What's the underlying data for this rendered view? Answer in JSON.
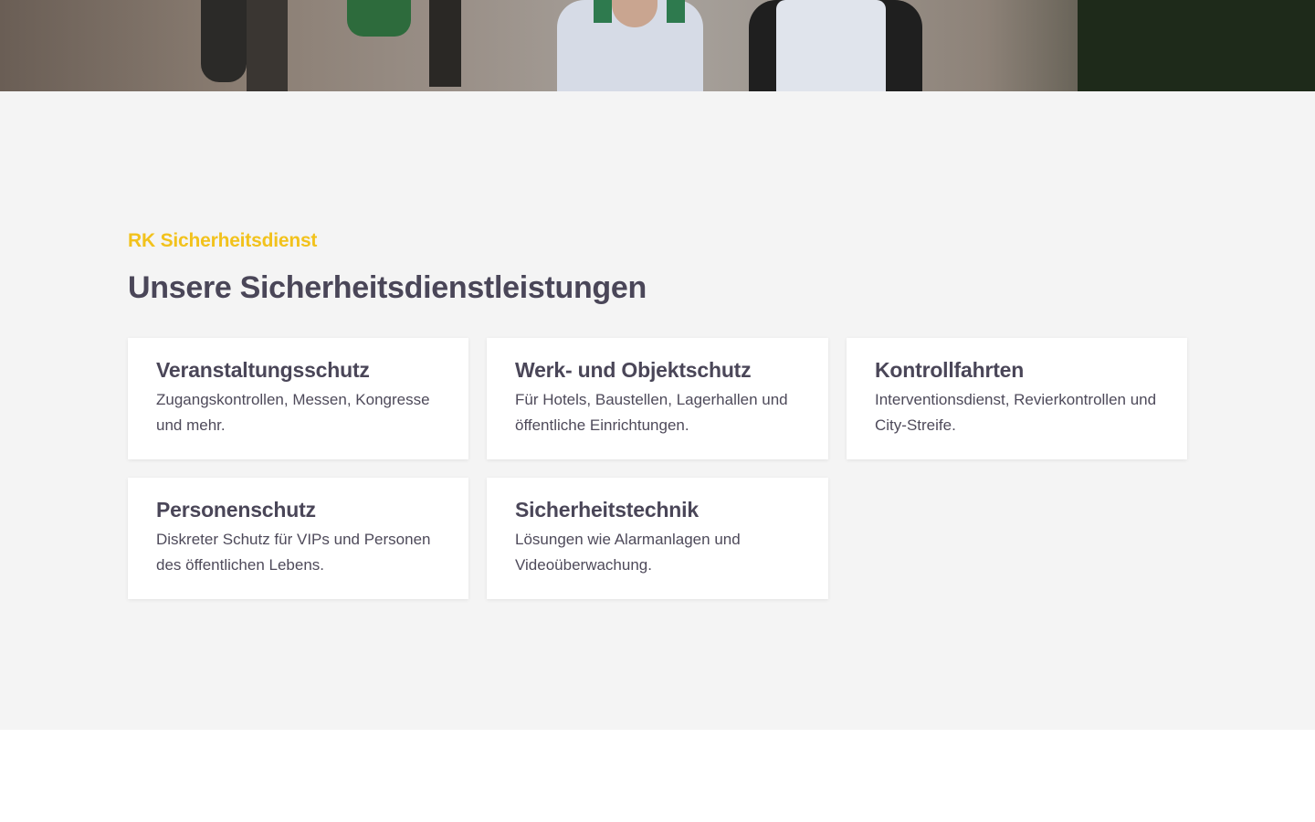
{
  "hero": {
    "image_alt": "Security staff in vests walking outdoors"
  },
  "services": {
    "eyebrow": "RK Sicherheitsdienst",
    "title": "Unsere Sicherheitsdienstleistungen",
    "cards": [
      {
        "title": "Veranstaltungsschutz",
        "text": "Zugangskontrollen, Messen, Kongresse und mehr."
      },
      {
        "title": "Werk- und Objektschutz",
        "text": "Für Hotels, Baustellen, Lagerhallen und öffentliche Einrichtungen."
      },
      {
        "title": "Kontrollfahrten",
        "text": "Interventionsdienst, Revierkontrollen und City-Streife."
      },
      {
        "title": "Personenschutz",
        "text": "Diskreter Schutz für VIPs und Personen des öffentlichen Lebens."
      },
      {
        "title": "Sicherheitstechnik",
        "text": "Lösungen wie Alarmanlagen und Videoüberwachung."
      }
    ]
  },
  "colors": {
    "accent": "#f2c21c",
    "heading": "#4a4658",
    "section_bg": "#f4f4f4",
    "card_bg": "#ffffff"
  }
}
